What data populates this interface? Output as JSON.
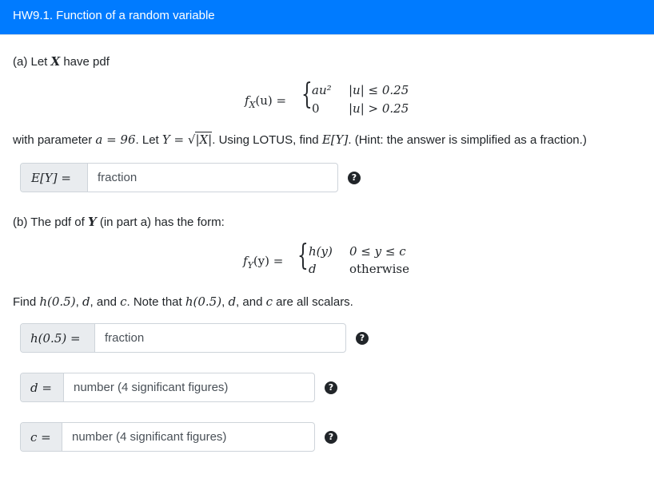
{
  "header": {
    "title": "HW9.1. Function of a random variable"
  },
  "part_a": {
    "intro_prefix": "(a) Let ",
    "intro_var": "X",
    "intro_suffix": " have pdf",
    "pdf_lhs": "f",
    "pdf_lhs_sub": "X",
    "pdf_lhs_arg": "(u) =",
    "case1_value": "au²",
    "case1_cond": "|u| ≤ 0.25",
    "case2_value": "0",
    "case2_cond": "|u| > 0.25",
    "sentence": {
      "p1": "with parameter ",
      "m1": "a = 96",
      "p2": ". Let ",
      "m2": "Y = √",
      "m2b": "|X|",
      "p3": ". Using LOTUS, find ",
      "m3": "E[Y]",
      "p4": ". (Hint: the answer is simplified as a fraction.)"
    },
    "answer": {
      "label": "E[Y] =",
      "placeholder": "fraction",
      "help": "?"
    }
  },
  "part_b": {
    "intro_prefix": "(b) The pdf of ",
    "intro_var": "Y",
    "intro_suffix": " (in part a) has the form:",
    "pdf_lhs": "f",
    "pdf_lhs_sub": "Y",
    "pdf_lhs_arg": "(y) =",
    "case1_value": "h(y)",
    "case1_cond": "0 ≤ y ≤ c",
    "case2_value": "d",
    "case2_cond": "otherwise",
    "sentence": {
      "p1": "Find ",
      "m1": "h(0.5)",
      "p2": ", ",
      "m2": "d",
      "p3": ", and ",
      "m3": "c",
      "p4": ". Note that ",
      "m4": "h(0.5)",
      "p5": ", ",
      "m5": "d",
      "p6": ", and ",
      "m6": "c",
      "p7": " are all scalars."
    },
    "answers": [
      {
        "label": "h(0.5) =",
        "placeholder": "fraction",
        "help": "?"
      },
      {
        "label": "d =",
        "placeholder": "number (4 significant figures)",
        "help": "?"
      },
      {
        "label": "c =",
        "placeholder": "number (4 significant figures)",
        "help": "?"
      }
    ]
  }
}
